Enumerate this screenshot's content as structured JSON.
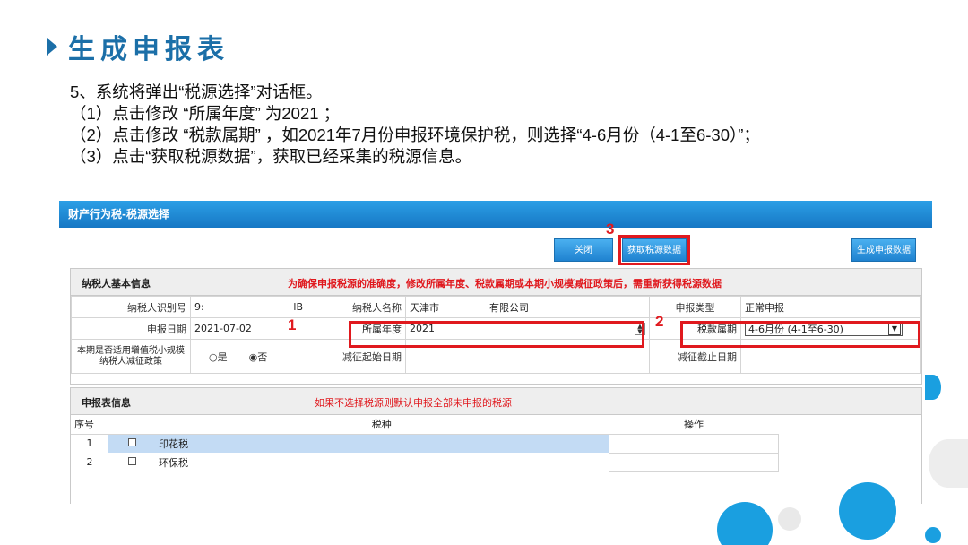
{
  "title": "生成申报表",
  "instructions": [
    "5、系统将弹出“税源选择”对话框。",
    "（1）点击修改 “所属年度” 为2021 ；",
    "（2）点击修改 “税款属期” ，如2021年7月份申报环境保护税，则选择“4-6月份（4-1至6-30）”；",
    "（3）点击“获取税源数据”，获取已经采集的税源信息。"
  ],
  "dialog": {
    "title": "财产行为税-税源选择",
    "buttons": {
      "close": "关闭",
      "fetch": "获取税源数据",
      "generate": "生成申报数据"
    },
    "markers": {
      "one": "1",
      "two": "2",
      "three": "3"
    },
    "basic": {
      "title": "纳税人基本信息",
      "warning": "为确保申报税源的准确度，修改所属年度、税款属期或本期小规模减征政策后，需重新获得税源数据",
      "taxpayer_id_label": "纳税人识别号",
      "taxpayer_id_prefix": "9:",
      "taxpayer_id_suffix": "lB",
      "taxpayer_name_label": "纳税人名称",
      "taxpayer_name_city": "天津市",
      "taxpayer_name_company": "有限公司",
      "report_type_label": "申报类型",
      "report_type_value": "正常申报",
      "report_date_label": "申报日期",
      "report_date_value": "2021-07-02",
      "year_label": "所属年度",
      "year_value": "2021",
      "period_label": "税款属期",
      "period_value": "4-6月份 (4-1至6-30)",
      "small_policy_label": "本期是否适用增值税小规模纳税人减征政策",
      "yes_label": "是",
      "no_label": "否",
      "start_date_label": "减征起始日期",
      "end_date_label": "减征截止日期"
    },
    "table": {
      "title": "申报表信息",
      "warning": "如果不选择税源则默认申报全部未申报的税源",
      "headers": {
        "seq": "序号",
        "tax": "税种",
        "op": "操作"
      },
      "rows": [
        {
          "seq": "1",
          "tax": "印花税"
        },
        {
          "seq": "2",
          "tax": "环保税"
        }
      ]
    }
  }
}
